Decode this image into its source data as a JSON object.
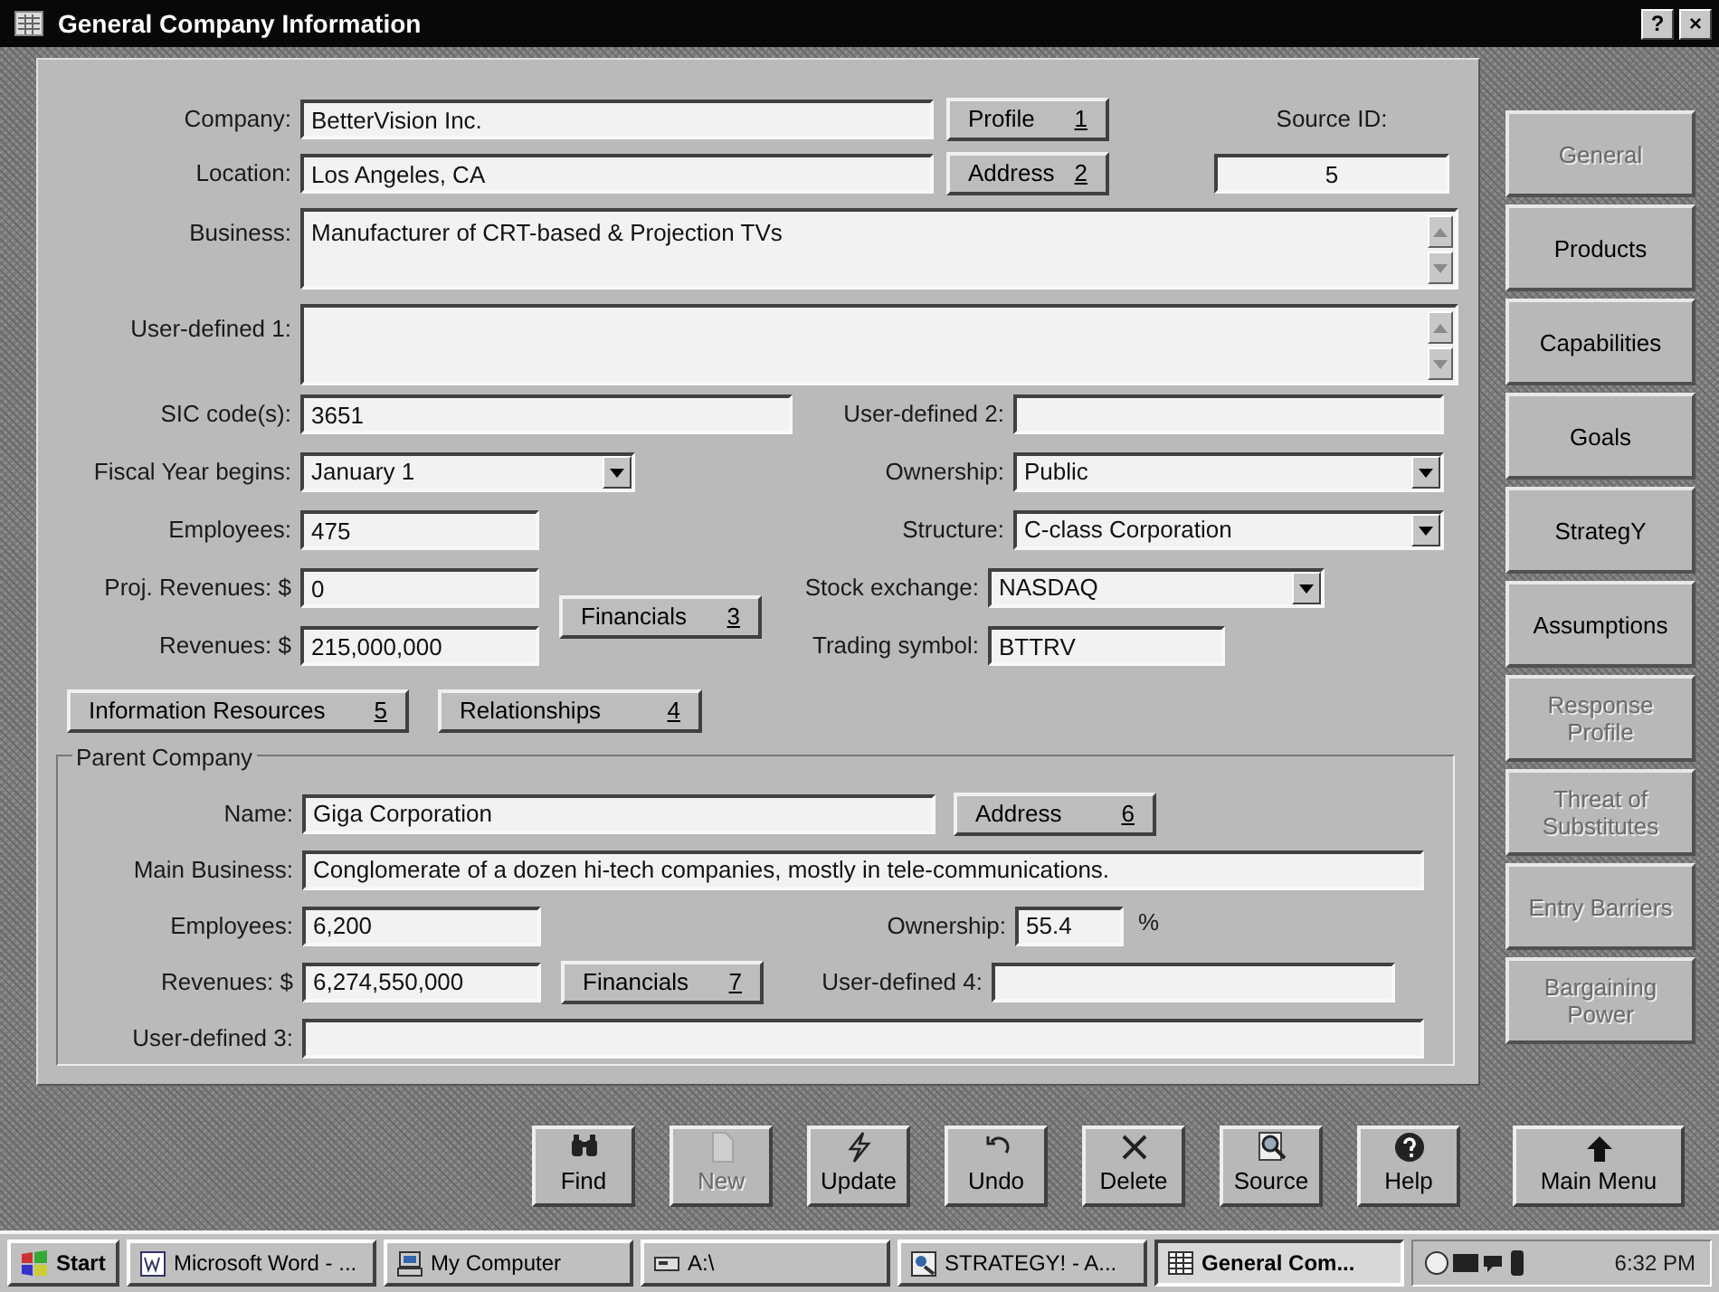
{
  "window": {
    "title": "General Company Information",
    "buttons": [
      "?",
      "×"
    ]
  },
  "company": {
    "company": {
      "label": "Company:",
      "value": "BetterVision Inc."
    },
    "profile_button": {
      "label": "Profile",
      "shortcut": "1"
    },
    "source_id": {
      "label": "Source ID:",
      "value": "5"
    },
    "location": {
      "label": "Location:",
      "value": "Los Angeles, CA"
    },
    "address_button": {
      "label": "Address",
      "shortcut": "2"
    },
    "business": {
      "label": "Business:",
      "value": "Manufacturer of CRT-based & Projection TVs"
    },
    "user_defined_1": {
      "label": "User-defined 1:"
    },
    "sic_codes": {
      "label": "SIC code(s):",
      "value": "3651"
    },
    "user_defined_2": {
      "label": "User-defined 2:"
    },
    "fiscal_year": {
      "label": "Fiscal Year begins:",
      "value": "January 1"
    },
    "ownership": {
      "label": "Ownership:",
      "value": "Public"
    },
    "employees": {
      "label": "Employees:",
      "value": "475"
    },
    "structure": {
      "label": "Structure:",
      "value": "C-class Corporation"
    },
    "proj_revenues": {
      "label": "Proj. Revenues: $",
      "value": "0"
    },
    "stock_exchange": {
      "label": "Stock exchange:",
      "value": "NASDAQ"
    },
    "financials_button": {
      "label": "Financials",
      "shortcut": "3"
    },
    "revenues": {
      "label": "Revenues: $",
      "value": "215,000,000"
    },
    "trading_symbol": {
      "label": "Trading symbol:",
      "value": "BTTRV"
    },
    "info_resources_button": {
      "label": "Information Resources",
      "shortcut": "5"
    },
    "relationships_button": {
      "label": "Relationships",
      "shortcut": "4"
    }
  },
  "parent_company": {
    "title": "Parent Company",
    "name": {
      "label": "Name:",
      "value": "Giga Corporation"
    },
    "address_button": {
      "label": "Address",
      "shortcut": "6"
    },
    "main_business": {
      "label": "Main Business:",
      "value": "Conglomerate of a dozen hi-tech companies, mostly in tele-communications."
    },
    "employees": {
      "label": "Employees:",
      "value": "6,200"
    },
    "ownership": {
      "label": "Ownership:",
      "value": "55.4",
      "unit": "%"
    },
    "revenues": {
      "label": "Revenues: $",
      "value": "6,274,550,000"
    },
    "financials_button": {
      "label": "Financials",
      "shortcut": "7"
    },
    "user_defined_4": {
      "label": "User-defined 4:"
    },
    "user_defined_3": {
      "label": "User-defined 3:"
    }
  },
  "sidebar": [
    {
      "label": "General",
      "disabled": true
    },
    {
      "label": "Products",
      "disabled": false
    },
    {
      "label": "Capabilities",
      "disabled": false
    },
    {
      "label": "Goals",
      "disabled": false
    },
    {
      "label": "StrategY",
      "disabled": false
    },
    {
      "label": "Assumptions",
      "disabled": false
    },
    {
      "label": "Response Profile",
      "disabled": true
    },
    {
      "label": "Threat of Substitutes",
      "disabled": true
    },
    {
      "label": "Entry Barriers",
      "disabled": true
    },
    {
      "label": "Bargaining Power",
      "disabled": true
    }
  ],
  "toolbar": [
    {
      "label": "Find",
      "disabled": false
    },
    {
      "label": "New",
      "disabled": true
    },
    {
      "label": "Update",
      "disabled": false
    },
    {
      "label": "Undo",
      "disabled": false
    },
    {
      "label": "Delete",
      "disabled": false
    },
    {
      "label": "Source",
      "disabled": false
    },
    {
      "label": "Help",
      "disabled": false
    }
  ],
  "main_menu": {
    "label": "Main Menu"
  },
  "taskbar": {
    "start": "Start",
    "tasks": [
      {
        "label": "Microsoft Word - ...",
        "selected": false
      },
      {
        "label": "My Computer",
        "selected": false
      },
      {
        "label": "A:\\",
        "selected": false
      },
      {
        "label": "STRATEGY! - A...",
        "selected": false
      },
      {
        "label": "General Com...",
        "selected": true
      }
    ],
    "clock": "6:32 PM"
  }
}
